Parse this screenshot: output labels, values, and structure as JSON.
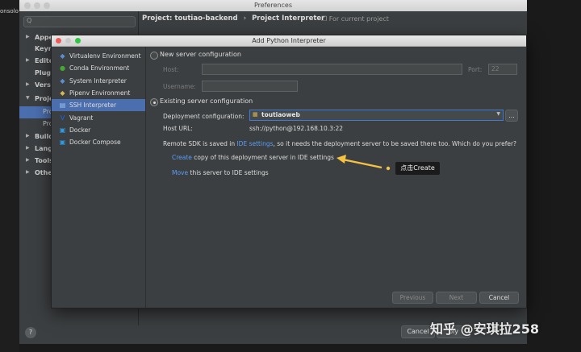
{
  "desktop": {
    "side_text": "onsolo"
  },
  "preferences": {
    "title": "Preferences",
    "search_placeholder": "Q",
    "tree": [
      {
        "label": "Appe",
        "arrow": "▶"
      },
      {
        "label": "Keym",
        "arrow": ""
      },
      {
        "label": "Edito",
        "arrow": "▶"
      },
      {
        "label": "Plugi",
        "arrow": ""
      },
      {
        "label": "Versi",
        "arrow": "▶"
      },
      {
        "label": "Proje",
        "arrow": "▼"
      },
      {
        "label": "Pro",
        "arrow": ""
      },
      {
        "label": "Pro",
        "arrow": ""
      },
      {
        "label": "Build",
        "arrow": "▶"
      },
      {
        "label": "Lang",
        "arrow": "▶"
      },
      {
        "label": "Tools",
        "arrow": "▶"
      },
      {
        "label": "Othe",
        "arrow": "▶"
      }
    ],
    "breadcrumb_project": "Project: toutiao-backend",
    "breadcrumb_sep": "›",
    "breadcrumb_page": "Project Interpreter",
    "for_current": "For current project",
    "help": "?",
    "cancel": "Cancel",
    "apply": "ply"
  },
  "dialog": {
    "title": "Add Python Interpreter",
    "environments": [
      {
        "label": "Virtualenv Environment",
        "icon": "python-icon",
        "glyph": "◆",
        "color": "#5b8fd0"
      },
      {
        "label": "Conda Environment",
        "icon": "conda-icon",
        "glyph": "●",
        "color": "#44a833"
      },
      {
        "label": "System Interpreter",
        "icon": "python-icon",
        "glyph": "◆",
        "color": "#5b8fd0"
      },
      {
        "label": "Pipenv Environment",
        "icon": "pipenv-icon",
        "glyph": "◆",
        "color": "#d6b656"
      },
      {
        "label": "SSH Interpreter",
        "icon": "ssh-icon",
        "glyph": "▤",
        "color": "#9cc2f2"
      },
      {
        "label": "Vagrant",
        "icon": "vagrant-icon",
        "glyph": "V",
        "color": "#1868f2"
      },
      {
        "label": "Docker",
        "icon": "docker-icon",
        "glyph": "▣",
        "color": "#2d9ce8"
      },
      {
        "label": "Docker Compose",
        "icon": "docker-compose-icon",
        "glyph": "▣",
        "color": "#2d9ce8"
      }
    ],
    "selected_env_index": 4,
    "new_server": {
      "label": "New server configuration",
      "host_label": "Host:",
      "port_label": "Port:",
      "port_value": "22",
      "username_label": "Username:"
    },
    "existing": {
      "label": "Existing server configuration",
      "deployment_label": "Deployment configuration:",
      "deployment_value": "toutiaoweb",
      "more_button": "...",
      "host_url_label": "Host URL:",
      "host_url_value": "ssh://python@192.168.10.3:22",
      "remote_sdk_prefix": "Remote SDK is saved in ",
      "remote_sdk_link": "IDE settings",
      "remote_sdk_suffix": ", so it needs the deployment server to be saved there too. Which do you prefer?",
      "create_link": "Create",
      "create_rest": " copy of this deployment server in IDE settings",
      "move_link": "Move",
      "move_rest": " this server to IDE settings"
    },
    "buttons": {
      "previous": "Previous",
      "next": "Next",
      "cancel": "Cancel"
    }
  },
  "annotation": {
    "callout": "点击Create",
    "arrow_color": "#f5c242"
  },
  "watermark": "知乎 @安琪拉258"
}
